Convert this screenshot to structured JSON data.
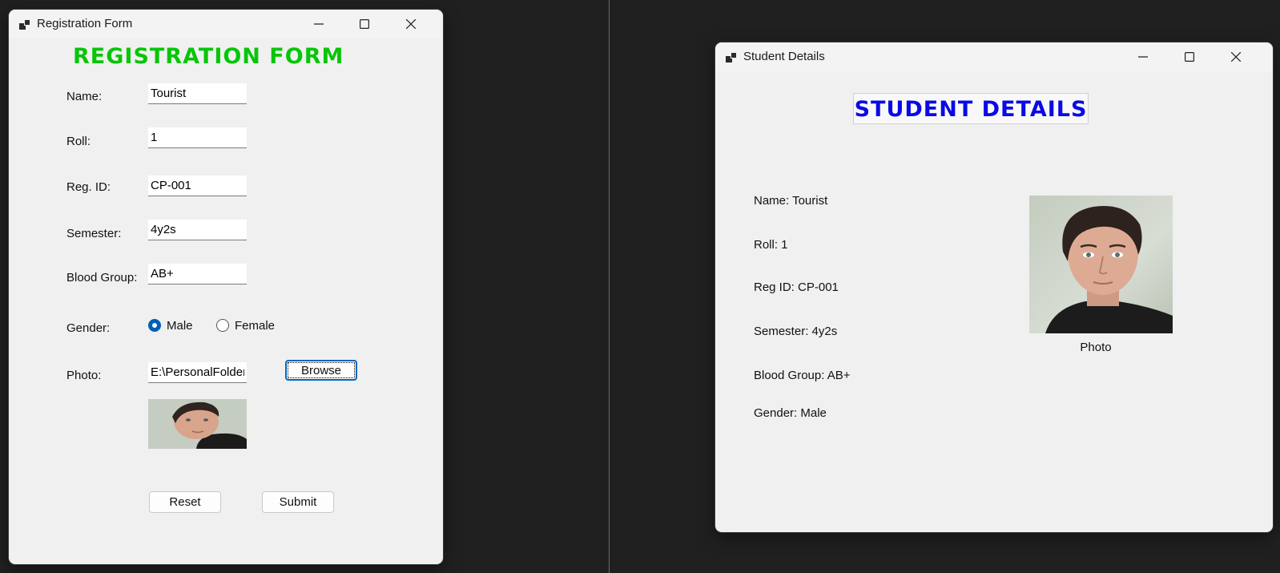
{
  "registration_window": {
    "title": "Registration Form",
    "heading": "Registration Form",
    "fields": {
      "name": {
        "label": "Name:",
        "value": "Tourist"
      },
      "roll": {
        "label": "Roll:",
        "value": "1"
      },
      "reg_id": {
        "label": "Reg. ID:",
        "value": "CP-001"
      },
      "semester": {
        "label": "Semester:",
        "value": "4y2s"
      },
      "blood_group": {
        "label": "Blood Group:",
        "value": "AB+"
      }
    },
    "gender": {
      "label": "Gender:",
      "options": [
        "Male",
        "Female"
      ],
      "selected": "Male"
    },
    "photo": {
      "label": "Photo:",
      "path_value": "E:\\PersonalFolder\\",
      "browse_label": "Browse"
    },
    "buttons": {
      "reset": "Reset",
      "submit": "Submit"
    }
  },
  "details_window": {
    "title": "Student Details",
    "heading": "Student Details",
    "lines": {
      "name": "Name: Tourist",
      "roll": "Roll: 1",
      "reg_id": "Reg ID: CP-001",
      "semester": "Semester: 4y2s",
      "blood_group": "Blood Group: AB+",
      "gender": "Gender: Male"
    },
    "photo_caption": "Photo"
  },
  "icons": [
    "app-icon",
    "minimize-icon",
    "maximize-icon",
    "close-icon"
  ],
  "colors": {
    "registration_heading": "#08c508",
    "details_heading": "#0a0ae6",
    "accent": "#005fb8"
  }
}
